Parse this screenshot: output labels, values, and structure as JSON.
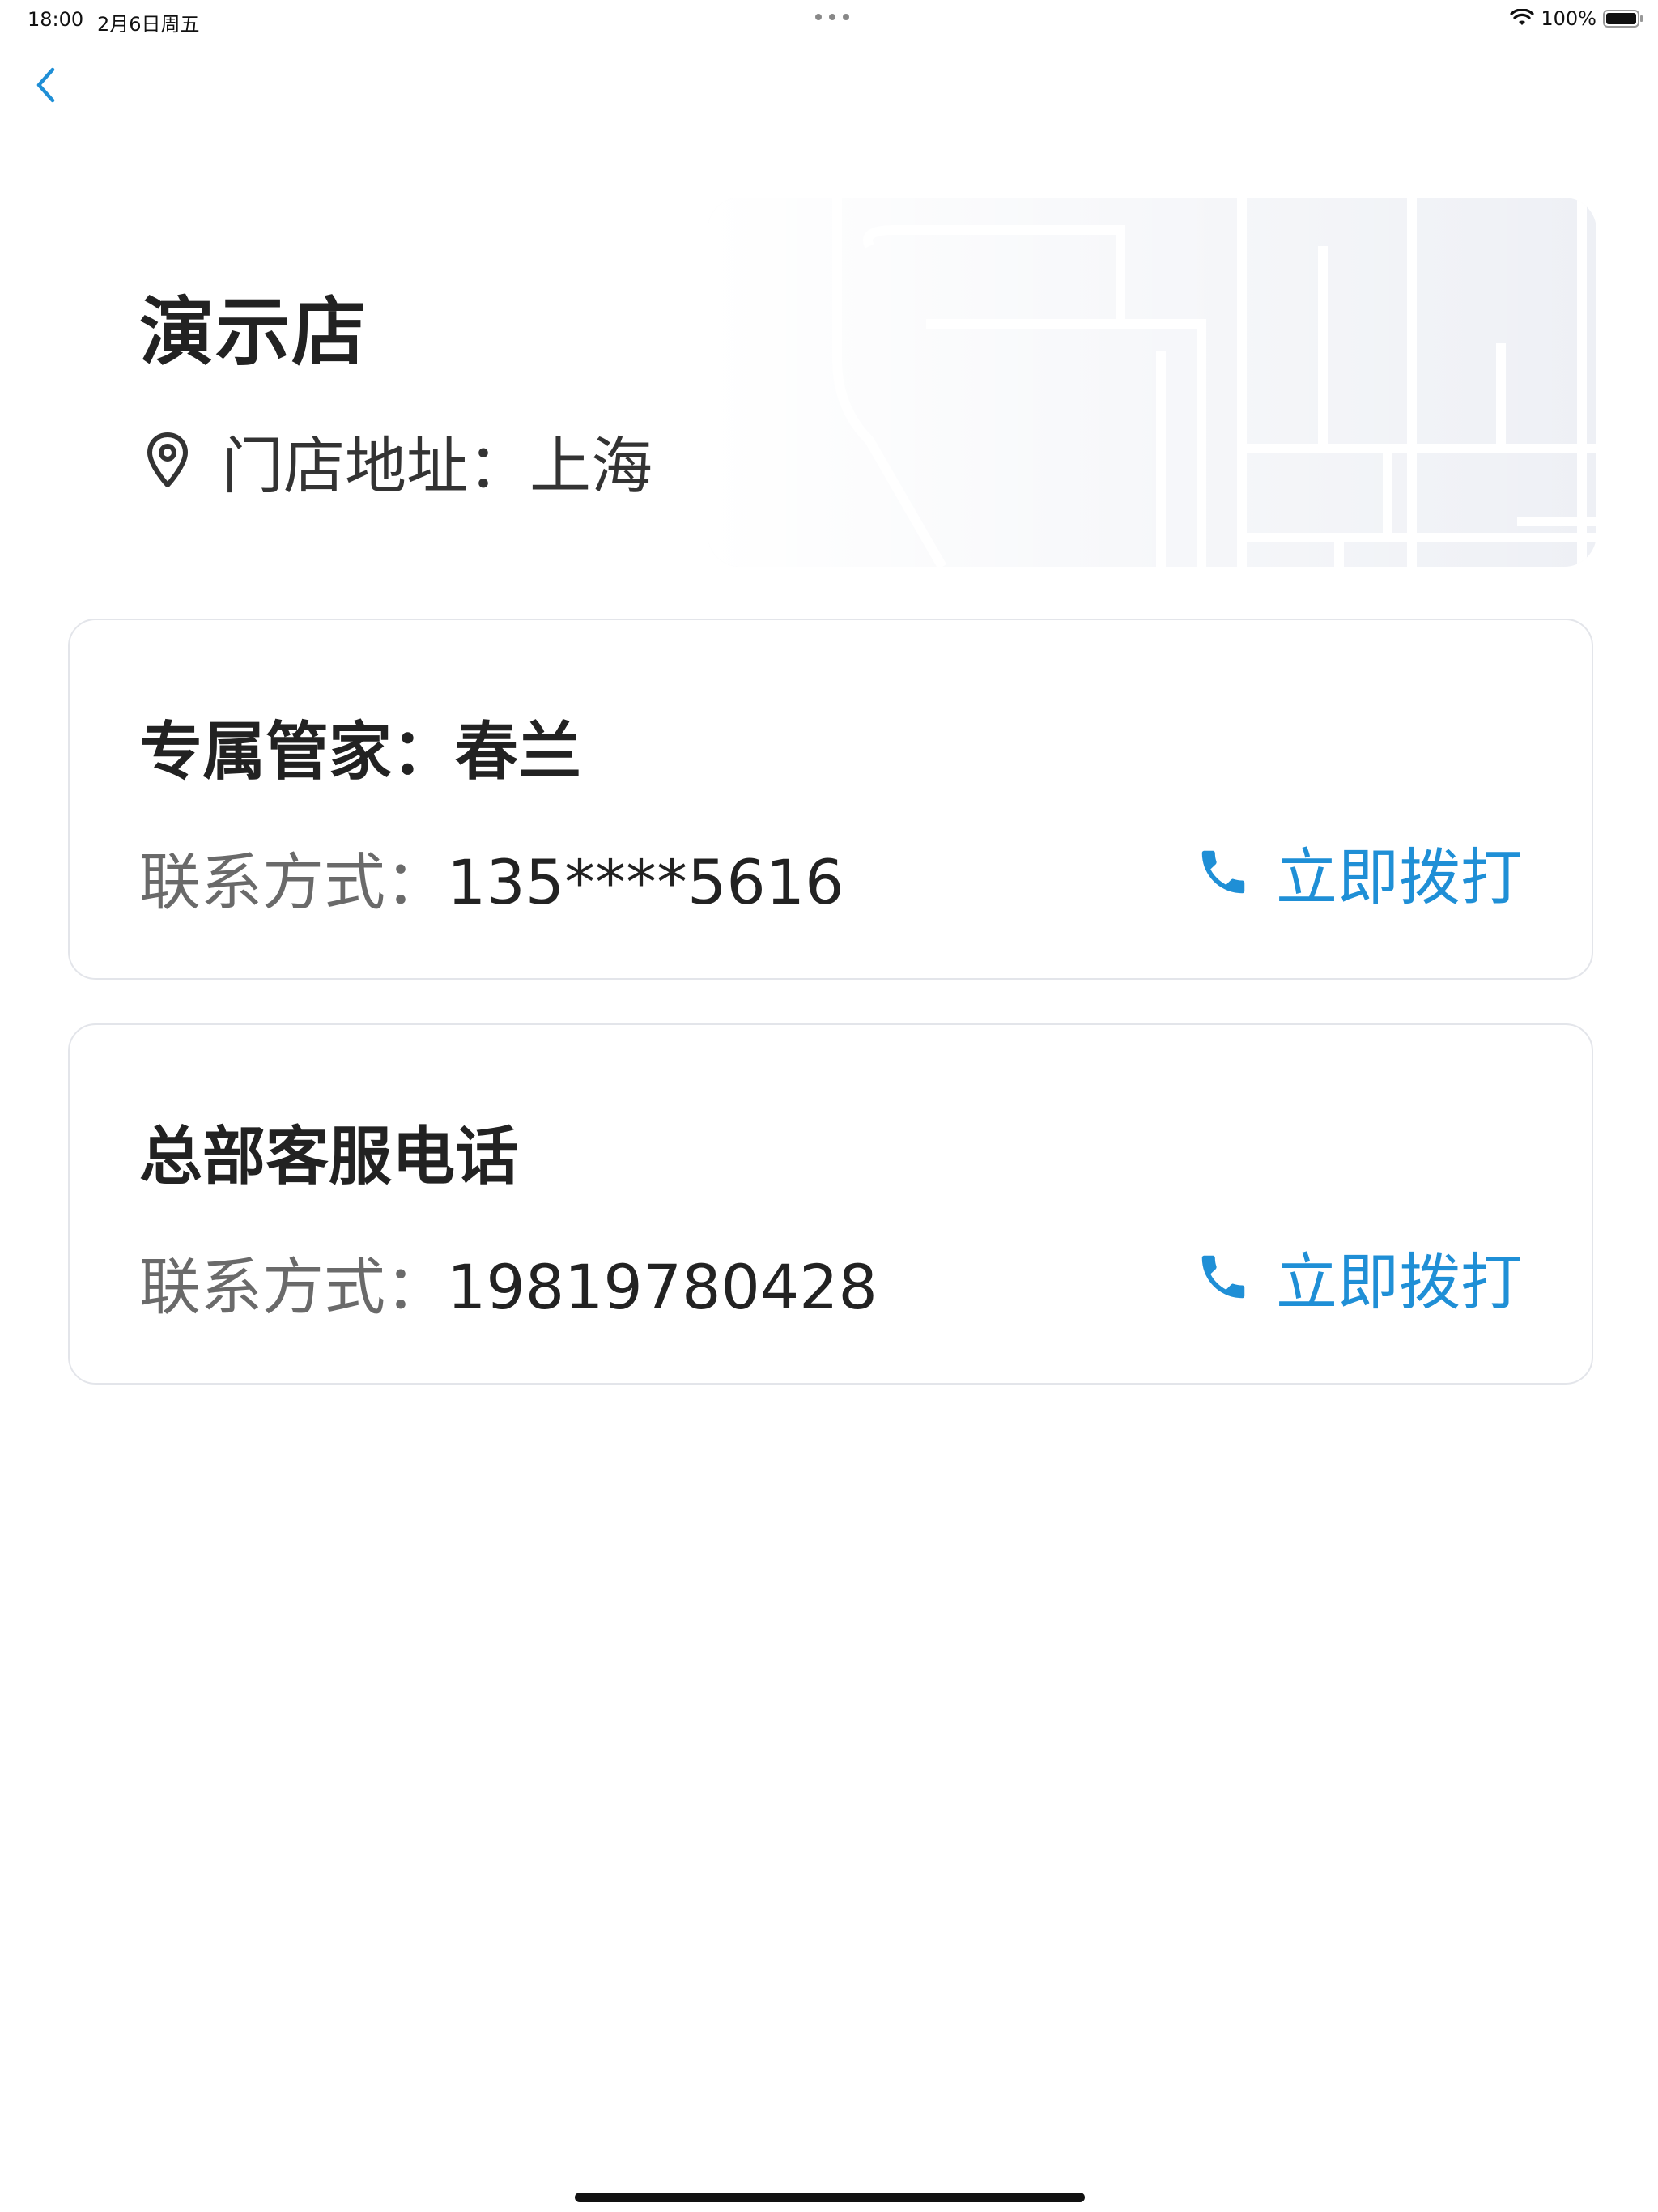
{
  "status_bar": {
    "time": "18:00",
    "date": "2月6日周五",
    "battery": "100%"
  },
  "store": {
    "name": "演示店",
    "address": "门店地址：上海"
  },
  "butler_card": {
    "title": "专属管家：春兰",
    "contact_label": "联系方式：",
    "contact_value": "135****5616",
    "call_label": "立即拨打"
  },
  "hq_card": {
    "title": "总部客服电话",
    "contact_label": "联系方式：",
    "contact_value": "19819780428",
    "call_label": "立即拨打"
  },
  "colors": {
    "accent": "#1f8fd6",
    "text_primary": "#222222",
    "text_secondary": "#6a6a6a",
    "card_border": "#e3e5ea"
  },
  "icons": [
    "back-chevron-icon",
    "wifi-icon",
    "battery-icon",
    "location-pin-icon",
    "phone-icon",
    "map-illustration"
  ]
}
